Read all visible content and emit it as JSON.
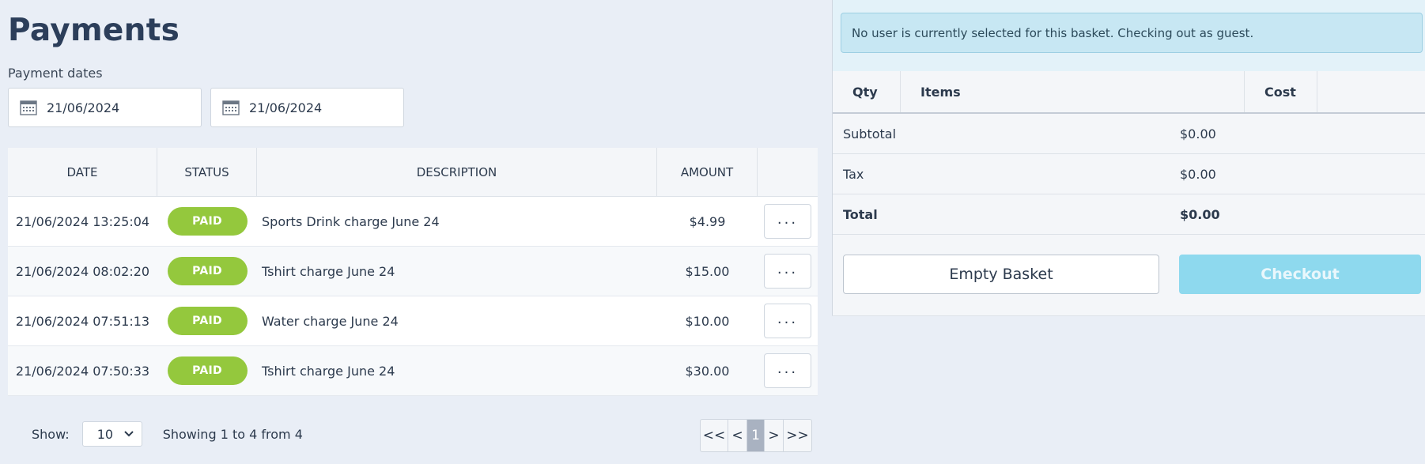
{
  "page": {
    "title": "Payments",
    "dates_label": "Payment dates"
  },
  "filters": {
    "date_from": "21/06/2024",
    "date_to": "21/06/2024"
  },
  "table": {
    "headers": {
      "date": "DATE",
      "status": "STATUS",
      "description": "DESCRIPTION",
      "amount": "AMOUNT"
    },
    "rows": [
      {
        "date": "21/06/2024 13:25:04",
        "status": "PAID",
        "description": "Sports Drink charge June 24",
        "amount": "$4.99",
        "action": "..."
      },
      {
        "date": "21/06/2024 08:02:20",
        "status": "PAID",
        "description": "Tshirt charge June 24",
        "amount": "$15.00",
        "action": "..."
      },
      {
        "date": "21/06/2024 07:51:13",
        "status": "PAID",
        "description": "Water charge June 24",
        "amount": "$10.00",
        "action": "..."
      },
      {
        "date": "21/06/2024 07:50:33",
        "status": "PAID",
        "description": "Tshirt charge June 24",
        "amount": "$30.00",
        "action": "..."
      }
    ]
  },
  "footer": {
    "show_label": "Show:",
    "page_size": "10",
    "showing_text": "Showing 1 to 4 from 4",
    "pager": {
      "first": "<<",
      "prev": "<",
      "current": "1",
      "next": ">",
      "last": ">>"
    }
  },
  "basket": {
    "alert": "No user is currently selected for this basket. Checking out as guest.",
    "headers": {
      "qty": "Qty",
      "items": "Items",
      "cost": "Cost"
    },
    "subtotal": {
      "label": "Subtotal",
      "value": "$0.00"
    },
    "tax": {
      "label": "Tax",
      "value": "$0.00"
    },
    "total": {
      "label": "Total",
      "value": "$0.00"
    },
    "empty_button": "Empty Basket",
    "checkout_button": "Checkout"
  },
  "colors": {
    "paid_badge": "#94c83d",
    "checkout_disabled": "#8ed9ee",
    "alert_bg": "#c7e7f3",
    "pager_current": "#a9b2c1"
  },
  "icons": {
    "date_field": "calendar-icon",
    "page_size": "chevron-down-icon"
  }
}
